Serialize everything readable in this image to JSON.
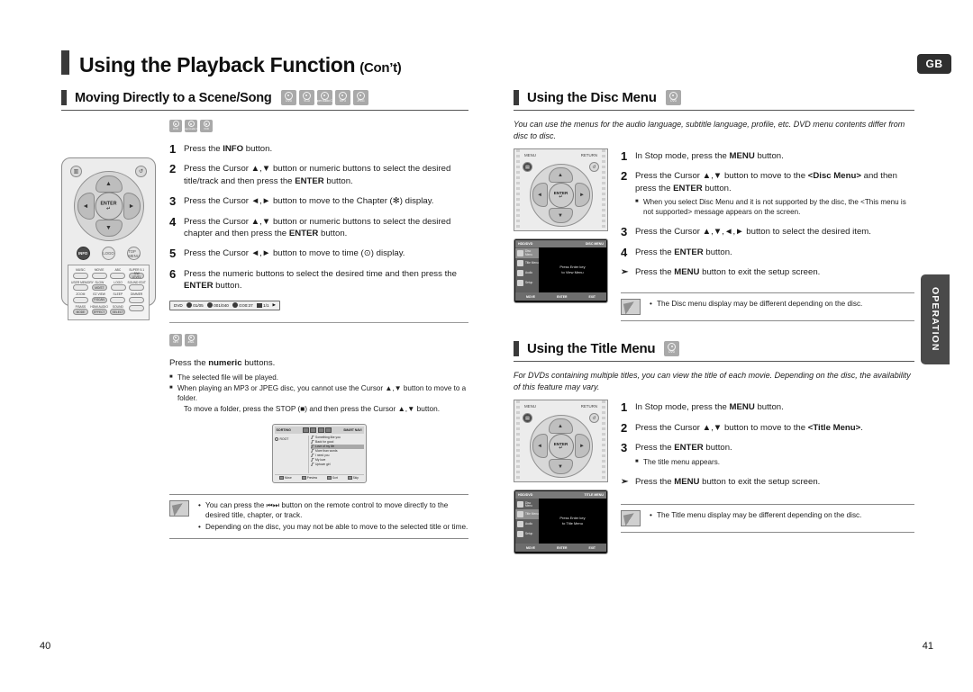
{
  "header": {
    "title": "Using the Playback Function",
    "title_suffix": "(Con’t)",
    "lang_tab": "GB",
    "side_tab": "OPERATION"
  },
  "footer": {
    "page_left": "40",
    "page_right": "41"
  },
  "disc_icons": {
    "dvd": "DVD",
    "vcd": "VCD",
    "cd": "Super Audio CD",
    "mp3": "MP3",
    "jpeg": "JPEG"
  },
  "sections": {
    "scene_song": {
      "heading": "Moving Directly to a Scene/Song",
      "disc_types": [
        "DVD",
        "VCD",
        "Super Audio CD",
        "MP3",
        "JPEG"
      ],
      "group1_disc_types": [
        "DVD",
        "Super Audio CD",
        "VCD"
      ],
      "steps": [
        {
          "num": "1",
          "text_html": "Press the <b>INFO</b> button."
        },
        {
          "num": "2",
          "text_html": "Press the Cursor ▲,▼ button or numeric buttons to select the desired title/track and then press the <b>ENTER</b> button."
        },
        {
          "num": "3",
          "text_html": "Press the Cursor ◄,► button to move to the Chapter (✻) display."
        },
        {
          "num": "4",
          "text_html": "Press the Cursor ▲,▼ button or numeric buttons to select the desired chapter and then press the <b>ENTER</b> button."
        },
        {
          "num": "5",
          "text_html": "Press the Cursor ◄,► button to move to time (⊙) display."
        },
        {
          "num": "6",
          "text_html": "Press the numeric buttons to select the desired time and then press the <b>ENTER</b> button."
        }
      ],
      "info_bar": {
        "disc_label": "DVD",
        "title": "01/05",
        "chapter": "001/040",
        "time": "0:00:37",
        "repeat": "1/1"
      },
      "group2_disc_types": [
        "MP3",
        "JPEG"
      ],
      "group2_lead_html": "Press the <b>numeric</b> buttons.",
      "group2_bullets": [
        "The selected file will be played.",
        "When playing an MP3 or JPEG disc, you cannot use the Cursor ▲,▼ button to move to a folder."
      ],
      "group2_extra": "To move a folder, press the STOP (■) and then press the Cursor ▲,▼ button.",
      "mp3_screen": {
        "sort_label": "SORTING",
        "smart_label": "SMART NAVI",
        "root_label": "ROOT",
        "songs": [
          "Something like you",
          "Back for good",
          "Love of my life",
          "More than words",
          "I need you",
          "My love",
          "Uptown girl"
        ],
        "selected_index": 2,
        "buttons": [
          "Move",
          "Preview",
          "Sort",
          "Skip"
        ]
      },
      "notes": [
        "You can press the ⏮⏭ button on the remote control to move directly to the desired title, chapter, or track.",
        "Depending on the disc, you may not be able to move to the selected title or time."
      ]
    },
    "disc_menu": {
      "heading": "Using the Disc Menu",
      "disc_types": [
        "DVD"
      ],
      "intro": "You can use the menus for the audio language, subtitle language, profile, etc. DVD menu contents differ from disc to disc.",
      "steps": [
        {
          "num": "1",
          "text_html": "In Stop mode, press the <b>MENU</b> button."
        },
        {
          "num": "2",
          "text_html": "Press the Cursor ▲,▼ button to move to the <b>&lt;Disc Menu&gt;</b> and then press the <b>ENTER</b> button."
        },
        {
          "num": "3",
          "text_html": "Press the Cursor ▲,▼,◄,► button to select the desired item."
        },
        {
          "num": "4",
          "text_html": "Press the <b>ENTER</b> button."
        }
      ],
      "step2_bullet": "When you select Disc Menu and it is not supported by the disc, the <This menu is not supported> message appears on the screen.",
      "arrow_note_html": "Press the <b>MENU</b> button to exit the setup screen.",
      "note": "The Disc menu display may be different depending on the disc.",
      "remote": {
        "menu_label": "MENU",
        "return_label": "RETURN",
        "enter_label": "ENTER"
      },
      "tv_screen": {
        "top_left": "HDD/DVD",
        "top_right": "DISC MENU",
        "items": [
          "Disc Menu",
          "Title Menu",
          "Audio",
          "Setup"
        ],
        "selected_index": 0,
        "message_line1": "Press Enter key",
        "message_line2": "to View Menu",
        "bottom": [
          "MOVE",
          "ENTER",
          "EXIT"
        ]
      }
    },
    "title_menu": {
      "heading": "Using the Title Menu",
      "disc_types": [
        "DVD"
      ],
      "intro": "For DVDs containing multiple titles, you can view the title of each movie. Depending on the disc, the availability of this feature may vary.",
      "steps": [
        {
          "num": "1",
          "text_html": "In Stop mode, press the <b>MENU</b> button."
        },
        {
          "num": "2",
          "text_html": "Press the Cursor ▲,▼ button to move to the <b>&lt;Title Menu&gt;</b>."
        },
        {
          "num": "3",
          "text_html": "Press the <b>ENTER</b> button."
        }
      ],
      "step3_bullet": "The title menu appears.",
      "arrow_note_html": "Press the <b>MENU</b> button to exit the setup screen.",
      "note": "The Title menu display may be different depending on the disc.",
      "remote": {
        "menu_label": "MENU",
        "return_label": "RETURN",
        "enter_label": "ENTER"
      },
      "tv_screen": {
        "top_left": "HDD/DVD",
        "top_right": "TITLE MENU",
        "items": [
          "Disc Menu",
          "Title Menu",
          "Audio",
          "Setup"
        ],
        "selected_index": 1,
        "message_line1": "Press Enter key",
        "message_line2": "to Title Menu",
        "bottom": [
          "MOVE",
          "ENTER",
          "EXIT"
        ]
      }
    }
  },
  "remote_large": {
    "menu_icon": "menu-icon",
    "return_icon": "return-icon",
    "enter_label": "ENTER",
    "round_buttons": [
      "INFO",
      "LOGO",
      "TOP MENU"
    ],
    "keypad_rows": [
      {
        "labels": [
          "MUSIC",
          "MOVIE",
          "ABC",
          "SUPER 5.1"
        ],
        "inner": [
          "",
          "",
          "",
          "S/W LEVEL"
        ]
      },
      {
        "labels": [
          "USER MEMORY",
          "SLOW",
          "LOGO",
          "SOUND EDIT"
        ],
        "inner": [
          "",
          "MO/ST",
          "",
          ""
        ]
      },
      {
        "labels": [
          "ZOOM",
          "EZ VIEW",
          "SLEEP",
          "DIMMER"
        ],
        "inner": [
          "",
          "P.SCAN",
          "",
          ""
        ]
      },
      {
        "labels": [
          "P.BASS",
          "HDMI AUDIO",
          "SOUND"
        ],
        "inner": [
          "MODE",
          "EFFECT",
          "SELECT",
          ""
        ]
      }
    ]
  }
}
